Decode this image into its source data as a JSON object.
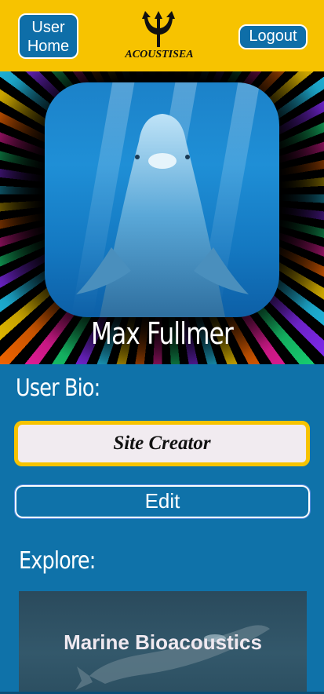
{
  "header": {
    "home_label": "User Home",
    "logout_label": "Logout",
    "logo_text": "ACOUSTISEA",
    "background_color": "#f7c300"
  },
  "profile": {
    "name": "Max Fullmer",
    "photo_icon": "dolphin-photo"
  },
  "bio": {
    "heading": "User Bio:",
    "text": "Site Creator",
    "edit_label": "Edit"
  },
  "explore": {
    "heading": "Explore:",
    "cards": [
      {
        "title": "Marine Bioacoustics",
        "image_icon": "whale-photo"
      }
    ]
  },
  "colors": {
    "accent": "#0f72a9",
    "brand_yellow": "#f7c300"
  }
}
